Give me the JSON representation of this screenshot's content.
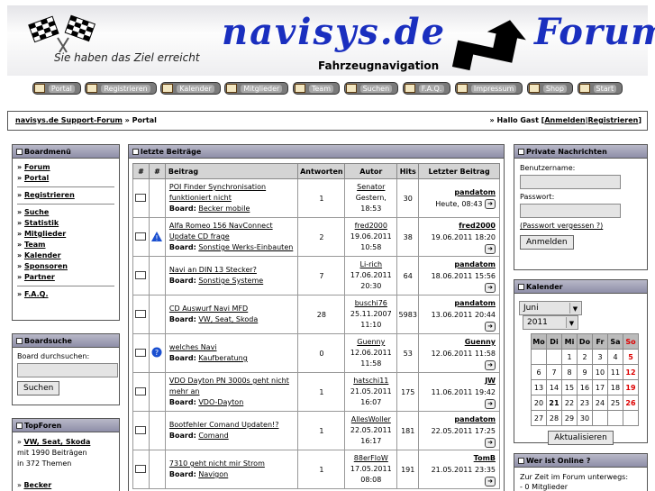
{
  "header": {
    "slogan": "Sie haben das Ziel erreicht",
    "logo_left": "navisys.de",
    "logo_right": "Forum",
    "subtitle": "Fahrzeugnavigation"
  },
  "nav": [
    "Portal",
    "Registrieren",
    "Kalender",
    "Mitglieder",
    "Team",
    "Suchen",
    "F.A.Q.",
    "Impressum",
    "Shop",
    "Start"
  ],
  "breadcrumb": {
    "site": "navisys.de Support-Forum",
    "sep": " » ",
    "page": "Portal",
    "greeting": "» Hallo Gast [",
    "login": "Anmelden",
    "pipe": "|",
    "register": "Registrieren",
    "close": "]"
  },
  "boardmenu": {
    "title": "Boardmenü",
    "g1": [
      "Forum",
      "Portal"
    ],
    "g2": [
      "Registrieren"
    ],
    "g3": [
      "Suche",
      "Statistik",
      "Mitglieder",
      "Team",
      "Kalender",
      "Sponsoren",
      "Partner"
    ],
    "g4": [
      "F.A.Q."
    ]
  },
  "boardsearch": {
    "title": "Boardsuche",
    "label": "Board durchsuchen:",
    "button": "Suchen"
  },
  "topforen": {
    "title": "TopForen",
    "item1": "VW, Seat, Skoda",
    "item1_line2": "mit 1990 Beiträgen",
    "item1_line3": "in 372 Themen",
    "item2": "Becker"
  },
  "posts": {
    "title": "letzte Beiträge",
    "headers": [
      "#",
      "#",
      "Beitrag",
      "Antworten",
      "Autor",
      "Hits",
      "Letzter Beitrag"
    ],
    "board_label": "Board:",
    "rows": [
      {
        "title": "POI Finder Synchronisation funktioniert nicht",
        "board": "Becker mobile",
        "answers": "1",
        "author": "Senator",
        "date": "Gestern,",
        "time": "18:53",
        "hits": "30",
        "last_user": "pandatom",
        "last_date": "Heute, 08:43",
        "icon2": ""
      },
      {
        "title": "Alfa Romeo 156 NavConnect Update CD frage",
        "board": "Sonstige Werks-Einbauten",
        "answers": "2",
        "author": "fred2000",
        "date": "19.06.2011",
        "time": "10:58",
        "hits": "38",
        "last_user": "fred2000",
        "last_date": "19.06.2011 18:20",
        "icon2": "warn"
      },
      {
        "title": "Navi an DIN 13 Stecker?",
        "board": "Sonstige Systeme",
        "answers": "7",
        "author": "Li-rich",
        "date": "17.06.2011",
        "time": "20:30",
        "hits": "64",
        "last_user": "pandatom",
        "last_date": "18.06.2011 15:56",
        "icon2": ""
      },
      {
        "title": "CD Auswurf Navi MFD",
        "board": "VW, Seat, Skoda",
        "answers": "28",
        "author": "buschi76",
        "date": "25.11.2007",
        "time": "11:10",
        "hits": "5983",
        "last_user": "pandatom",
        "last_date": "13.06.2011 20:44",
        "icon2": ""
      },
      {
        "title": "welches Navi",
        "board": "Kaufberatung",
        "answers": "0",
        "author": "Guenny",
        "date": "12.06.2011",
        "time": "11:58",
        "hits": "53",
        "last_user": "Guenny",
        "last_date": "12.06.2011 11:58",
        "icon2": "question"
      },
      {
        "title": "VDO Dayton PN 3000s geht nicht mehr an",
        "board": "VDO-Dayton",
        "answers": "1",
        "author": "hatschi11",
        "date": "21.05.2011",
        "time": "16:07",
        "hits": "175",
        "last_user": "JW",
        "last_date": "11.06.2011 19:42",
        "icon2": ""
      },
      {
        "title": "Bootfehler Comand Updaten!?",
        "board": "Comand",
        "answers": "1",
        "author": "AllesWoller",
        "date": "22.05.2011",
        "time": "16:17",
        "hits": "181",
        "last_user": "pandatom",
        "last_date": "22.05.2011 17:25",
        "icon2": ""
      },
      {
        "title": "7310 geht nicht mir Strom",
        "board": "Navigon",
        "answers": "1",
        "author": "88erFloW",
        "date": "17.05.2011",
        "time": "08:08",
        "hits": "191",
        "last_user": "TomB",
        "last_date": "21.05.2011 23:35",
        "icon2": ""
      }
    ]
  },
  "pm": {
    "title": "Private Nachrichten",
    "user_label": "Benutzername:",
    "pass_label": "Passwort:",
    "forgot": "(Passwort vergessen ?)",
    "button": "Anmelden"
  },
  "calendar": {
    "title": "Kalender",
    "month": "Juni",
    "year": "2011",
    "days": [
      "Mo",
      "Di",
      "Mi",
      "Do",
      "Fr",
      "Sa",
      "So"
    ],
    "weeks": [
      [
        "",
        "",
        "1",
        "2",
        "3",
        "4",
        "5"
      ],
      [
        "6",
        "7",
        "8",
        "9",
        "10",
        "11",
        "12"
      ],
      [
        "13",
        "14",
        "15",
        "16",
        "17",
        "18",
        "19"
      ],
      [
        "20",
        "21",
        "22",
        "23",
        "24",
        "25",
        "26"
      ],
      [
        "27",
        "28",
        "29",
        "30",
        "",
        "",
        ""
      ]
    ],
    "button": "Aktualisieren"
  },
  "online": {
    "title": "Wer ist Online ?",
    "line1": "Zur Zeit im Forum unterwegs:",
    "line2": "- 0 Mitglieder"
  }
}
